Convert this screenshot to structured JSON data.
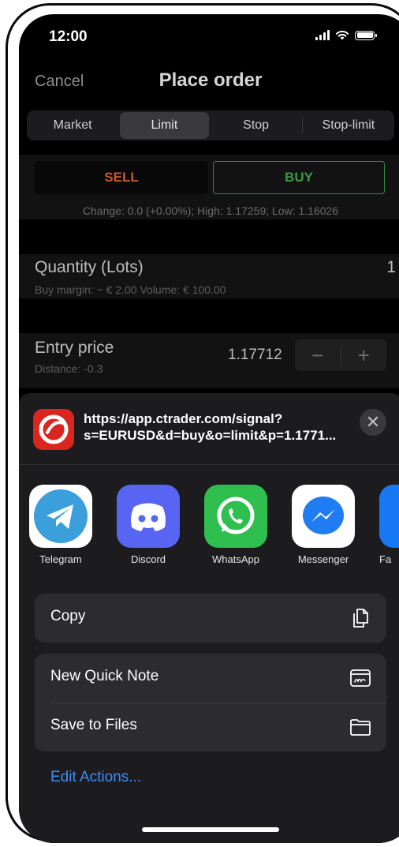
{
  "status_bar": {
    "time": "12:00"
  },
  "header": {
    "cancel_label": "Cancel",
    "title": "Place order"
  },
  "order_types": [
    "Market",
    "Limit",
    "Stop",
    "Stop-limit"
  ],
  "selected_order_type": "Limit",
  "trade": {
    "sell_label": "SELL",
    "buy_label": "BUY",
    "change_text": "Change: 0.0 (+0.00%); High: 1.17259; Low: 1.16026"
  },
  "quantity": {
    "label": "Quantity (Lots)",
    "value": "1",
    "sub": "Buy margin: ~ € 2.00  Volume: € 100.00"
  },
  "entry": {
    "label": "Entry price",
    "value": "1.17712",
    "sub": "Distance: -0.3",
    "minus": "−",
    "plus": "+"
  },
  "share_sheet": {
    "url_line1": "https://app.ctrader.com/signal?",
    "url_line2": "s=EURUSD&d=buy&o=limit&p=1.1771...",
    "close_glyph": "✕",
    "apps": [
      {
        "label": "Telegram",
        "icon": "telegram-icon",
        "color": "#3a9fdb"
      },
      {
        "label": "Discord",
        "icon": "discord-icon",
        "color": "#5865f2"
      },
      {
        "label": "WhatsApp",
        "icon": "whatsapp-icon",
        "color": "#2fbf4e"
      },
      {
        "label": "Messenger",
        "icon": "messenger-icon",
        "color": "#ffffff"
      },
      {
        "label": "Fa",
        "icon": "facebook-icon",
        "color": "#1877f2"
      }
    ],
    "actions": [
      {
        "label": "Copy",
        "icon": "copy-icon"
      },
      {
        "label": "New Quick Note",
        "icon": "quick-note-icon"
      },
      {
        "label": "Save to Files",
        "icon": "folder-icon"
      }
    ],
    "edit_actions_label": "Edit Actions..."
  }
}
